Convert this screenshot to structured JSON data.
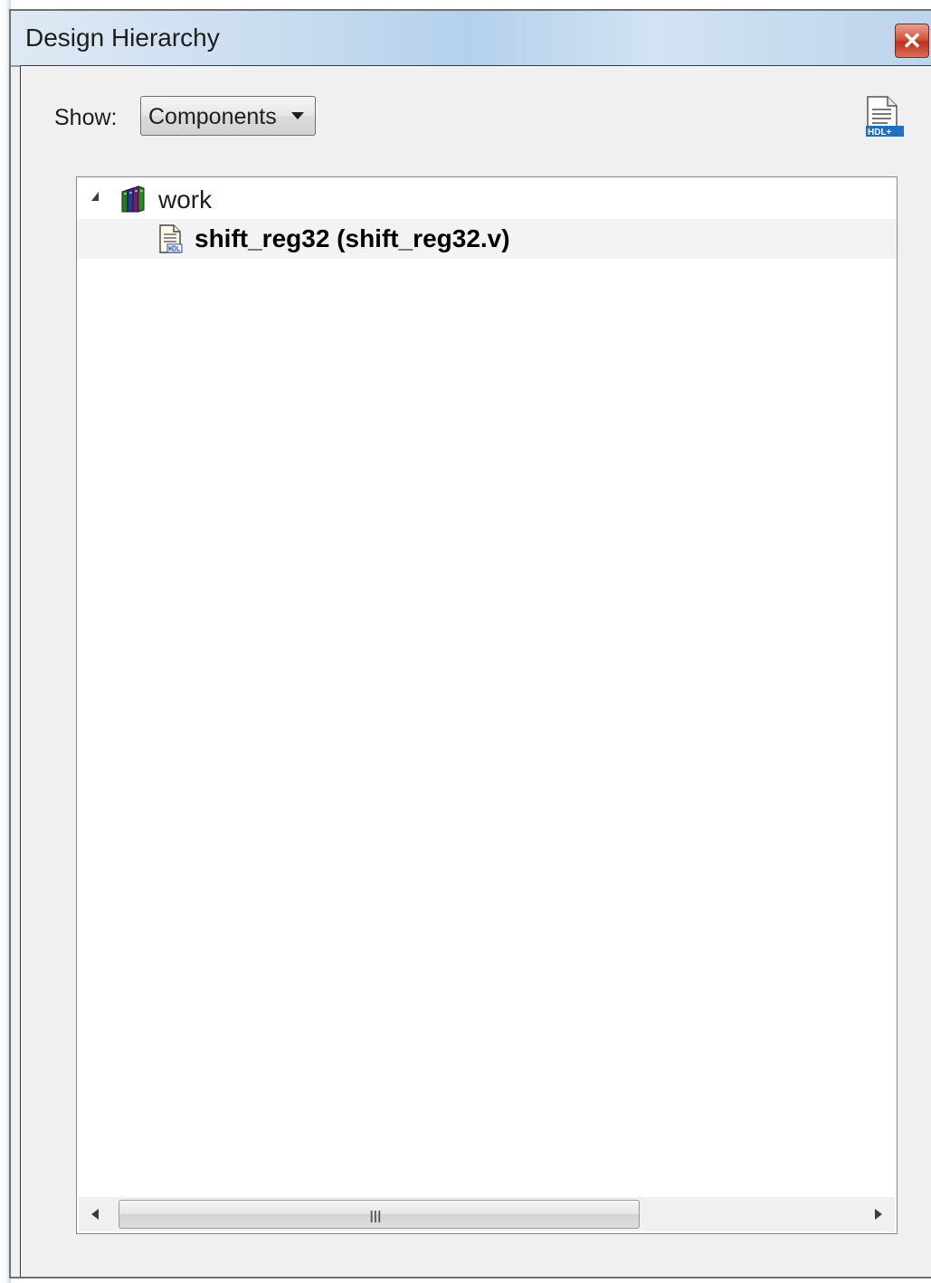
{
  "window": {
    "title": "Design Hierarchy",
    "close_icon": "close-icon"
  },
  "toolbar": {
    "show_label": "Show:",
    "show_selected": "Components",
    "add_hdl_icon": "hdl-plus-icon",
    "add_hdl_badge": "HDL+"
  },
  "tree": {
    "items": [
      {
        "label": "work",
        "icon": "library-books-icon",
        "expanded": true
      },
      {
        "label": "shift_reg32 (shift_reg32.v)",
        "icon": "hdl-file-icon"
      }
    ]
  },
  "scrollbar": {
    "grip": "III"
  },
  "colors": {
    "title_gradient": "#c8dcf0",
    "close_red": "#c0301a",
    "panel_bg": "#f0f0f0",
    "selected_row": "#f3f3f3"
  }
}
